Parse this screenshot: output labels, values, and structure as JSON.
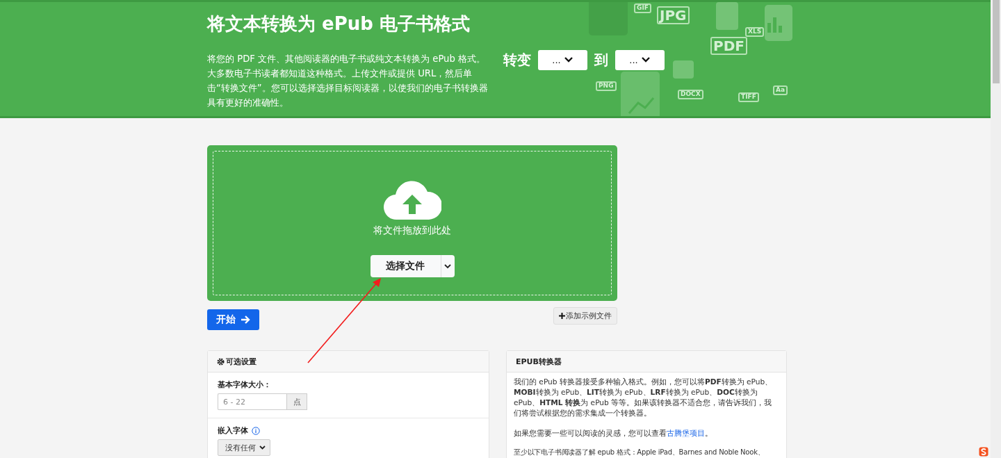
{
  "header": {
    "title": "将文本转换为 ePub 电子书格式",
    "description": "将您的 PDF 文件、其他阅读器的电子书或纯文本转换为 ePub 格式。大多数电子书读者都知道这种格式。上传文件或提供 URL，然后单击“转换文件”。您可以选择选择目标阅读器，以使我们的电子书转换器具有更好的准确性。",
    "converter": {
      "from_label": "转变",
      "from_value": "...",
      "to_label": "到",
      "to_value": "..."
    },
    "background_icons": [
      {
        "label": "GIF"
      },
      {
        "label": "JPG"
      },
      {
        "label": "XLS"
      },
      {
        "label": "PDF"
      },
      {
        "label": "PNG"
      },
      {
        "label": "DOCX"
      },
      {
        "label": "TIFF"
      },
      {
        "label": "Aa"
      }
    ]
  },
  "upload": {
    "drop_text": "将文件拖放到此处",
    "choose_button": "选择文件"
  },
  "start_button": "开始",
  "add_sample_button": "添加示例文件",
  "options_panel": {
    "title": "可选设置",
    "font_size": {
      "label": "基本字体大小：",
      "placeholder": "6 - 22",
      "unit": "点"
    },
    "embed_font": {
      "label": "嵌入字体",
      "value": "没有任何"
    }
  },
  "info_panel": {
    "title": "EPUB转换器",
    "paragraphs": [
      {
        "text": "我们的 ePub 转换器接受多种输入格式。例如，您可以将**PDF**转换为 ePub、**MOBI**转换为 ePub、**LIT**转换为 ePub、**LRF**转换为 ePub、**DOC**转换为 ePub、**HTML 转换**为 ePub 等等。如果该转换器不适合您，请告诉我们，我们将尝试根据您的需求集成一个转换器。"
      },
      {
        "text": "如果您需要一些可以阅读的灵感，您可以查看",
        "link": "古腾堡项目",
        "after": "。"
      },
      {
        "text": "至少以下电子书阅读器了解 epub 格式：Apple iPad、Barnes and Noble Nook、"
      }
    ]
  }
}
